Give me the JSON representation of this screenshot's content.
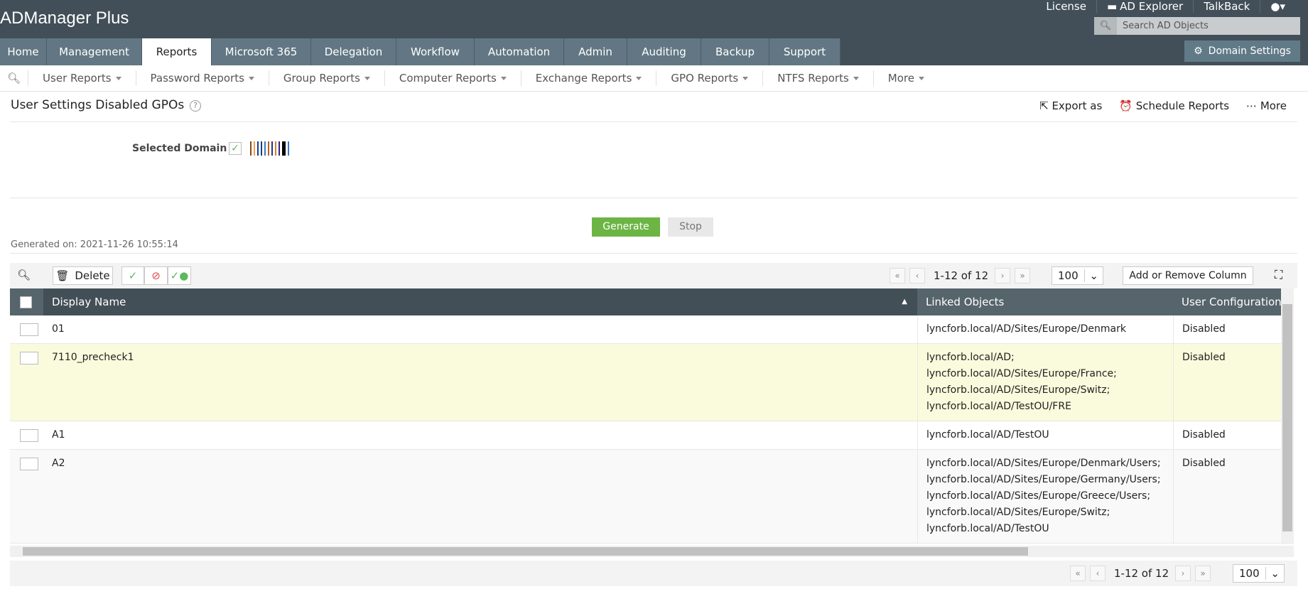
{
  "app": {
    "name": "ADManager Plus"
  },
  "top_links": [
    "License",
    "AD Explorer",
    "TalkBack"
  ],
  "search": {
    "placeholder": "Search AD Objects"
  },
  "domain_settings": "Domain Settings",
  "tabs": [
    "Home",
    "Management",
    "Reports",
    "Microsoft 365",
    "Delegation",
    "Workflow",
    "Automation",
    "Admin",
    "Auditing",
    "Backup",
    "Support"
  ],
  "active_tab": "Reports",
  "subnav": [
    "User Reports",
    "Password Reports",
    "Group Reports",
    "Computer Reports",
    "Exchange Reports",
    "GPO Reports",
    "NTFS Reports",
    "More"
  ],
  "page": {
    "title": "User Settings Disabled GPOs",
    "help": "?"
  },
  "actions": {
    "export": "Export as",
    "schedule": "Schedule Reports",
    "more": "More"
  },
  "form": {
    "selected_domain_label": "Selected Domain",
    "generate": "Generate",
    "stop": "Stop"
  },
  "generated_on": "Generated on: 2021-11-26 10:55:14",
  "toolbar": {
    "delete": "Delete",
    "page_info": "1-12 of 12",
    "page_size": "100",
    "add_remove": "Add or Remove Column"
  },
  "table": {
    "columns": [
      "Display Name",
      "Linked Objects",
      "User Configuration S"
    ],
    "rows": [
      {
        "name": "01",
        "linked": "lyncforb.local/AD/Sites/Europe/Denmark",
        "status": "Disabled"
      },
      {
        "name": "7110_precheck1",
        "linked": "lyncforb.local/AD;\nlyncforb.local/AD/Sites/Europe/France;\nlyncforb.local/AD/Sites/Europe/Switz;\nlyncforb.local/AD/TestOU/FRE",
        "status": "Disabled",
        "highlight": true
      },
      {
        "name": "A1",
        "linked": "lyncforb.local/AD/TestOU",
        "status": "Disabled"
      },
      {
        "name": "A2",
        "linked": "lyncforb.local/AD/Sites/Europe/Denmark/Users;\nlyncforb.local/AD/Sites/Europe/Germany/Users;\nlyncforb.local/AD/Sites/Europe/Greece/Users;\nlyncforb.local/AD/Sites/Europe/Switz;\nlyncforb.local/AD/TestOU",
        "status": "Disabled"
      }
    ]
  },
  "colors": {
    "topbar": "#424f58",
    "tab": "#627783",
    "generate": "#6cb545",
    "highlight_row": "#fafbdc"
  }
}
